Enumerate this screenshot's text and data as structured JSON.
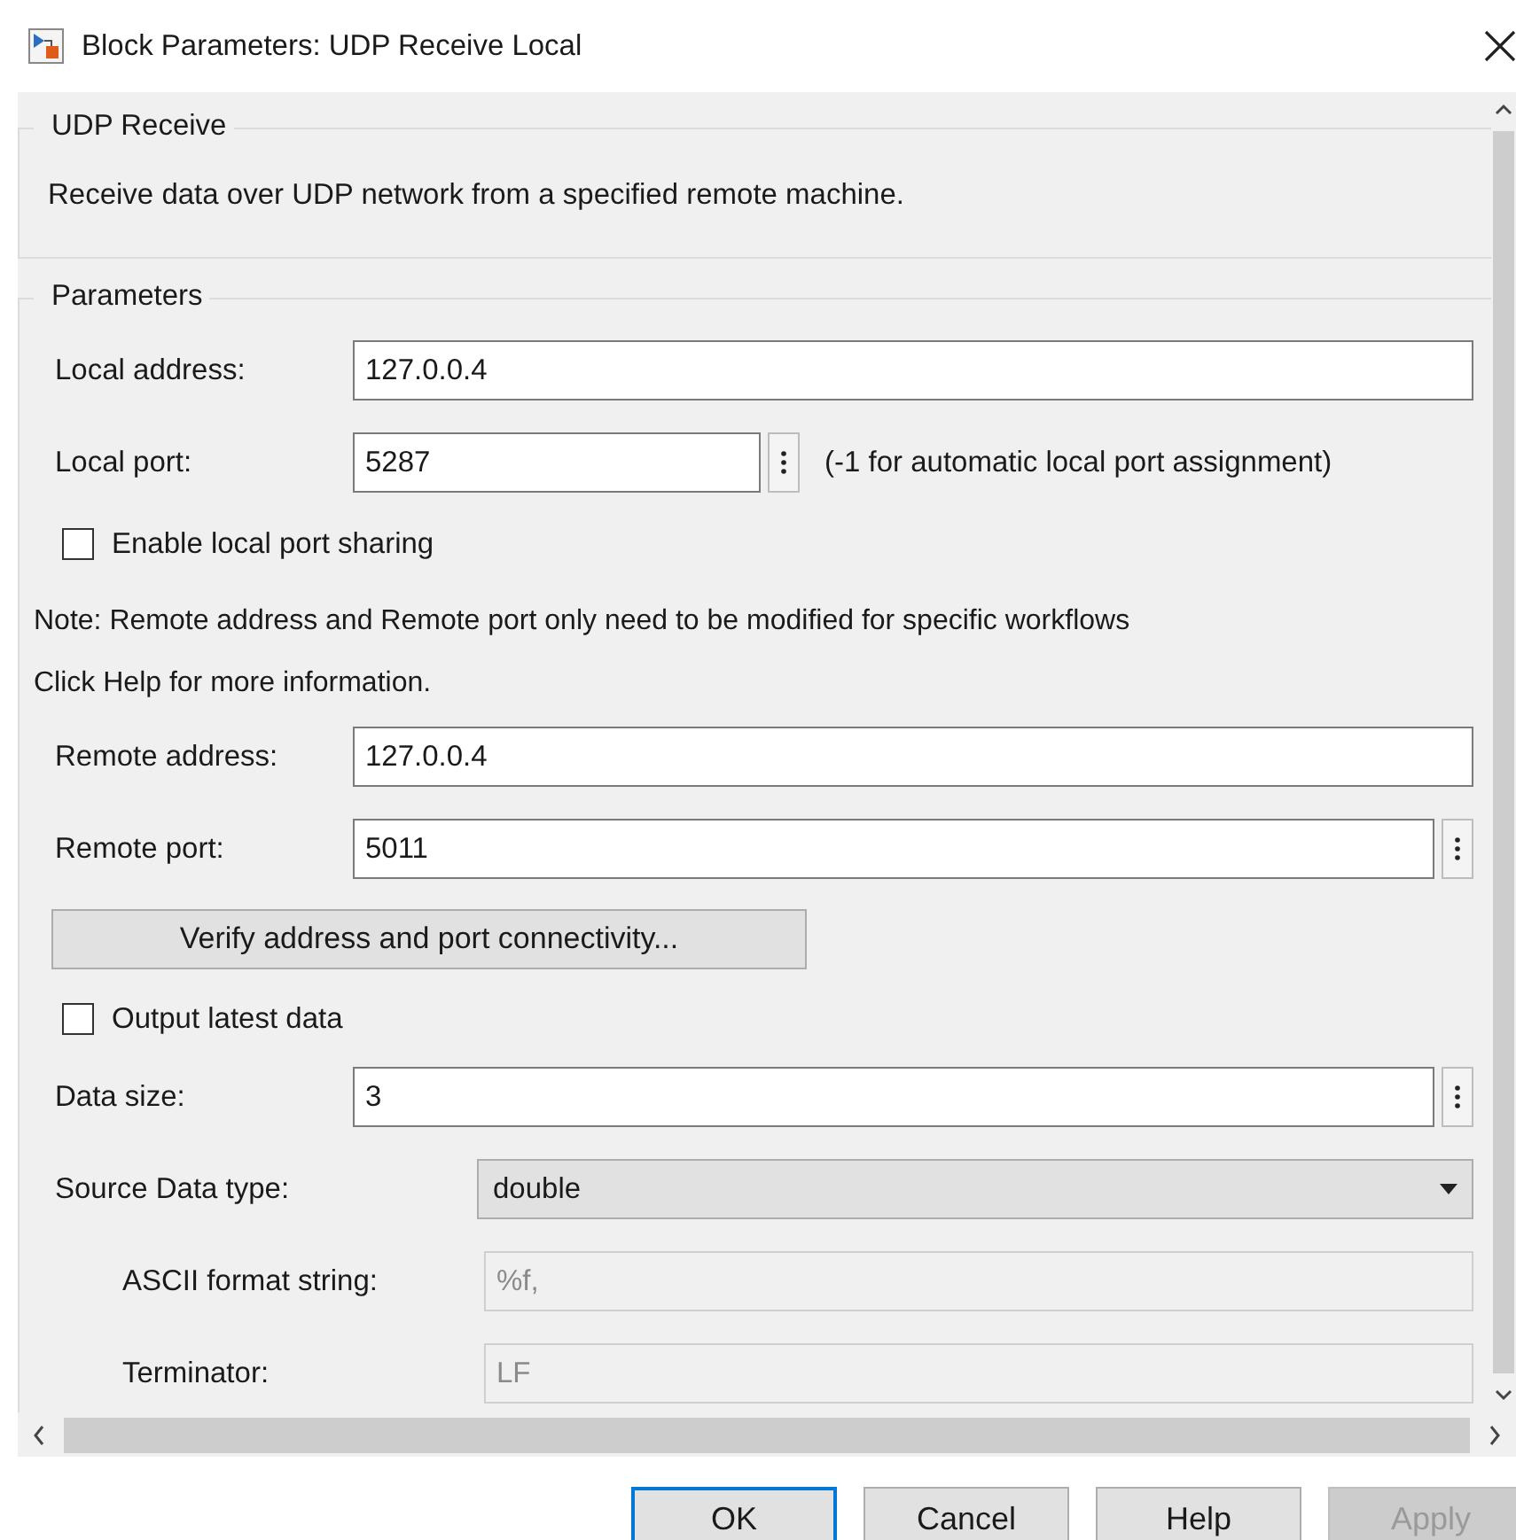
{
  "window": {
    "title": "Block Parameters: UDP Receive Local"
  },
  "description": {
    "heading": "UDP Receive",
    "text": "Receive data over UDP network from a specified remote machine."
  },
  "parameters": {
    "heading": "Parameters",
    "items": [
      {
        "kind": "text",
        "label": "Local address:",
        "value": "127.0.0.4"
      },
      {
        "kind": "text-menu",
        "label": "Local port:",
        "value": "5287",
        "hint": "(-1 for automatic local port assignment)"
      },
      {
        "kind": "checkbox",
        "label": "Enable local port sharing",
        "checked": false
      },
      {
        "kind": "note",
        "lines": [
          "Note: Remote address and Remote port only need to be modified for specific workflows",
          "Click Help for more information."
        ]
      },
      {
        "kind": "text",
        "label": "Remote address:",
        "value": "127.0.0.4"
      },
      {
        "kind": "text-menu",
        "label": "Remote port:",
        "value": "5011"
      },
      {
        "kind": "button",
        "label": "Verify address and port connectivity..."
      },
      {
        "kind": "checkbox",
        "label": "Output latest data",
        "checked": false
      },
      {
        "kind": "text-menu",
        "label": "Data size:",
        "value": "3"
      },
      {
        "kind": "dropdown",
        "label": "Source Data type:",
        "value": "double",
        "children": [
          {
            "kind": "text",
            "label": "ASCII format string:",
            "value": "%f,",
            "disabled": true
          },
          {
            "kind": "text",
            "label": "Terminator:",
            "value": "LF",
            "disabled": true
          }
        ]
      }
    ]
  },
  "buttons": [
    {
      "label": "OK",
      "focused": true,
      "disabled": false
    },
    {
      "label": "Cancel",
      "focused": false,
      "disabled": false
    },
    {
      "label": "Help",
      "focused": false,
      "disabled": false
    },
    {
      "label": "Apply",
      "focused": false,
      "disabled": true
    }
  ]
}
